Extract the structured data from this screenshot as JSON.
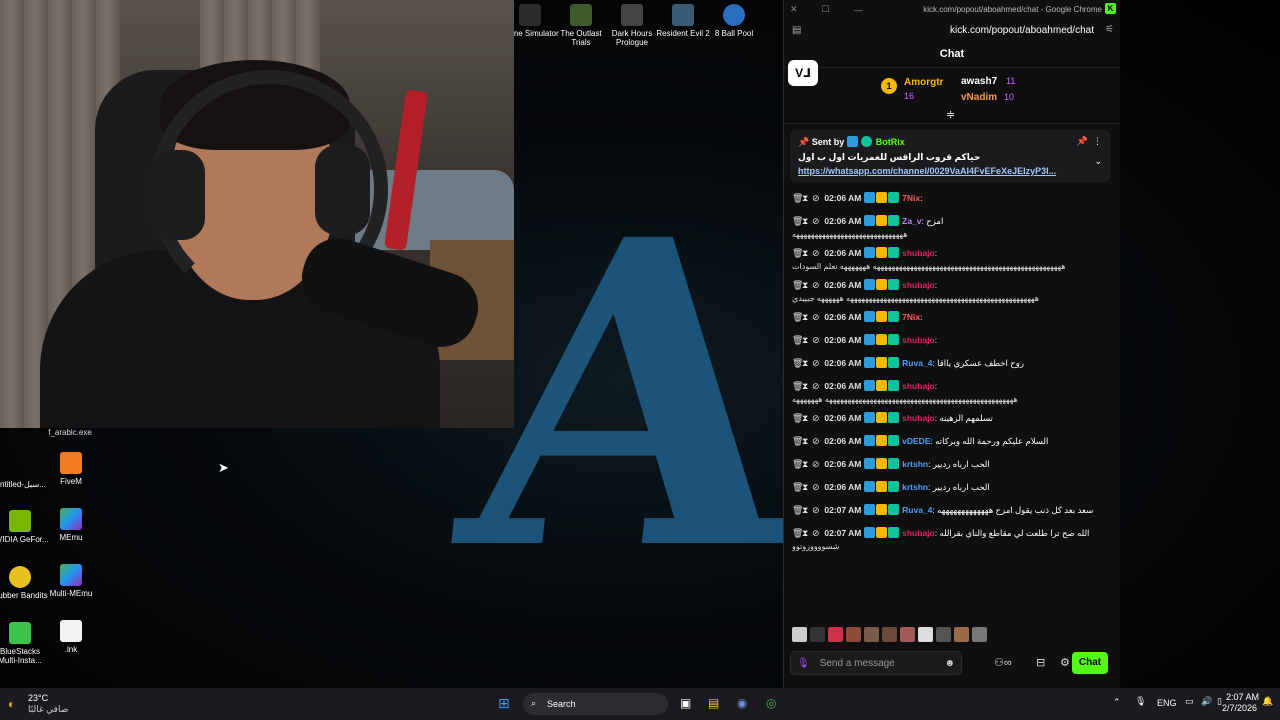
{
  "desktop": {
    "top_icons": [
      {
        "label": "Crime Simulator"
      },
      {
        "label": "The Outlast Trials"
      },
      {
        "label": "Dark Hours Prologue"
      },
      {
        "label": "Resident Evil 2"
      },
      {
        "label": "8 Ball Pool"
      }
    ],
    "left_icons": [
      {
        "label": "Untitled-سيل..."
      },
      {
        "label": "FiveM"
      },
      {
        "label": "NVIDIA GeFor..."
      },
      {
        "label": "MEmu"
      },
      {
        "label": "Rubber Bandits"
      },
      {
        "label": "Multi-MEmu"
      },
      {
        "label": "BlueStacks Multi-Insta..."
      },
      {
        "label": ".lnk"
      }
    ],
    "exe_label": "f_arabic.exe",
    "background_text": "AB"
  },
  "browser": {
    "title": "kick.com/popout/aboahmed/chat - Google Chrome",
    "url": "kick.com/popout/aboahmed/chat"
  },
  "chat": {
    "header": "Chat",
    "top_gifters": [
      {
        "rank": "1",
        "name": "Amorgtr",
        "count": "16"
      },
      {
        "name": "awash7",
        "count": "11"
      },
      {
        "name": "vNadim",
        "count": "10"
      }
    ],
    "pinned": {
      "sent_by": "Sent by",
      "user": "BotRix",
      "text": "حياكم قروب الراقس للعمريات اول ب اول",
      "link": "https://whatsapp.com/channel/0029VaAI4FvEFeXeJEIzyP3l..."
    },
    "messages": [
      {
        "time": "02:06 AM",
        "user": "7Nix",
        "color": "#ff5b5b",
        "text": ":",
        "cont": ""
      },
      {
        "time": "02:06 AM",
        "user": "Za_v",
        "color": "#c77dff",
        "text": ": امزح",
        "cont": "ههههههههههههههههههههههههههههههه"
      },
      {
        "time": "02:06 AM",
        "user": "shubajo",
        "color": "#e0245e",
        "text": ":",
        "cont": "هههههههههههههههههههههههههههههههههههههههههههههههههههه هههههههه نعلم السودات"
      },
      {
        "time": "02:06 AM",
        "user": "shubajo",
        "color": "#e0245e",
        "text": ":",
        "cont": "هههههههههههههههههههههههههههههههههههههههههههههههههههه ههههههه جيييدي"
      },
      {
        "time": "02:06 AM",
        "user": "7Nix",
        "color": "#ff5b5b",
        "text": ":",
        "cont": ""
      },
      {
        "time": "02:06 AM",
        "user": "shubajo",
        "color": "#e0245e",
        "text": ":",
        "cont": ""
      },
      {
        "time": "02:06 AM",
        "user": "Ruva_4",
        "color": "#4d9fff",
        "text": ": روح اخطف عسكري يااقا",
        "cont": ""
      },
      {
        "time": "02:06 AM",
        "user": "shubajo",
        "color": "#e0245e",
        "text": ":",
        "cont": "هههههههههههههههههههههههههههههههههههههههههههههههههههه هههههههه"
      },
      {
        "time": "02:06 AM",
        "user": "shubajo",
        "color": "#e0245e",
        "text": ": تسلمهم الرهينه",
        "cont": ""
      },
      {
        "time": "02:06 AM",
        "user": "vDEDE",
        "color": "#4d9fff",
        "text": ": السلام عليكم ورحمة الله وبركاته",
        "cont": ""
      },
      {
        "time": "02:06 AM",
        "user": "krtshn",
        "color": "#4d9fff",
        "text": ": الحب ارباه رديير",
        "cont": ""
      },
      {
        "time": "02:06 AM",
        "user": "krtshn",
        "color": "#4d9fff",
        "text": ": الحب ارباه رديير",
        "cont": ""
      },
      {
        "time": "02:07 AM",
        "user": "Ruva_4",
        "color": "#4d9fff",
        "text": ": سعد بعد كل ذنب يقول امزح هههههههههههههه",
        "cont": ""
      },
      {
        "time": "02:07 AM",
        "user": "shubajo",
        "color": "#e0245e",
        "text": ": الله صح ترا طلعت لي مقاطع والناي بقرالله",
        "cont": "شسووووزوتوو"
      }
    ],
    "input_placeholder": "Send a message",
    "send_label": "Chat"
  },
  "taskbar": {
    "weather_temp": "23°C",
    "weather_desc": "صافي غالبًا",
    "search_label": "Search",
    "lang": "ENG",
    "time": "2:07 AM",
    "date": "2/7/2026"
  },
  "colors": {
    "kick_green": "#53fc18",
    "accent_purple": "#a64dff",
    "gold": "#f5b800"
  }
}
